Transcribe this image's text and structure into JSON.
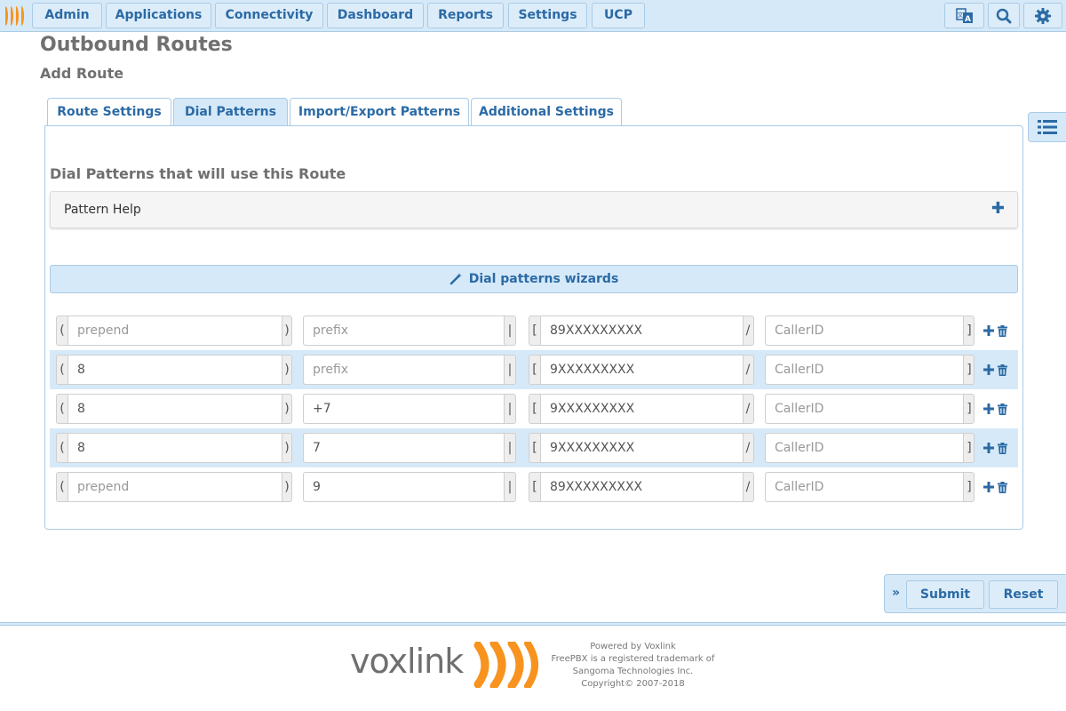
{
  "nav": {
    "items": [
      "Admin",
      "Applications",
      "Connectivity",
      "Dashboard",
      "Reports",
      "Settings",
      "UCP"
    ],
    "icons": [
      "translate-icon",
      "search-icon",
      "gear-icon"
    ]
  },
  "page": {
    "title": "Outbound Routes",
    "subtitle": "Add Route"
  },
  "tabs": [
    "Route Settings",
    "Dial Patterns",
    "Import/Export Patterns",
    "Additional Settings"
  ],
  "active_tab": "Dial Patterns",
  "section": {
    "heading": "Dial Patterns that will use this Route",
    "help_label": "Pattern Help",
    "wizard_label": "Dial patterns wizards"
  },
  "placeholders": {
    "prepend": "prepend",
    "prefix": "prefix",
    "callerid": "CallerID"
  },
  "addons": {
    "open_paren": "(",
    "close_paren": ")",
    "pipe": "|",
    "open_bracket": "[",
    "slash": "/",
    "close_bracket": "]"
  },
  "dial_patterns": [
    {
      "prepend": "",
      "prefix": "",
      "match": "89XXXXXXXXX",
      "callerid": ""
    },
    {
      "prepend": "8",
      "prefix": "",
      "match": "9XXXXXXXXX",
      "callerid": ""
    },
    {
      "prepend": "8",
      "prefix": "+7",
      "match": "9XXXXXXXXX",
      "callerid": ""
    },
    {
      "prepend": "8",
      "prefix": "7",
      "match": "9XXXXXXXXX",
      "callerid": ""
    },
    {
      "prepend": "",
      "prefix": "9",
      "match": "89XXXXXXXXX",
      "callerid": ""
    }
  ],
  "actions": {
    "submit": "Submit",
    "reset": "Reset"
  },
  "footer": {
    "brand": "voxlink",
    "lines": [
      "Powered by Voxlink",
      "FreePBX is a registered trademark of",
      "Sangoma Technologies Inc.",
      "Copyright© 2007-2018"
    ]
  },
  "colors": {
    "accent": "#2b6aa5",
    "nav_bg": "#d6e9f8",
    "brand_orange": "#f7931e"
  }
}
